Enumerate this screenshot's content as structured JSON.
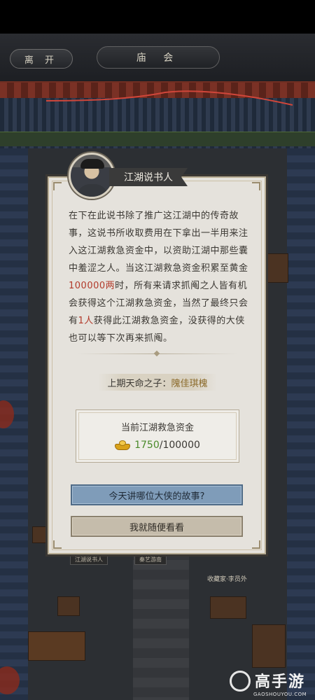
{
  "topbar": {
    "leave_label": "离 开",
    "title": "庙 会"
  },
  "scene": {
    "sign_left": "江湖说书人",
    "sign_mid": "秦艺游南",
    "npc_tag": "收藏家·李员外"
  },
  "dialog": {
    "speaker": "江湖说书人",
    "story": {
      "p1": "在下在此说书除了推广这江湖中的传奇故事，这说书所收取费用在下拿出一半用来注入这江湖救急资金中，以资助江湖中那些囊中羞涩之人。当这江湖救急资金积累至黄金",
      "amount": "100000两",
      "p2": "时，所有来请求抓阄之人皆有机会获得这个江湖救急资金，当然了最终只会有",
      "winners": "1人",
      "p3": "获得此江湖救急资金，没获得的大侠也可以等下次再来抓阄。"
    },
    "last_winner_label": "上期天命之子：",
    "last_winner_name": "隗佳琪槐",
    "fund": {
      "title": "当前江湖救急资金",
      "current": "1750",
      "separator": "/",
      "max": "100000",
      "icon": "gold-ingot-icon"
    },
    "primary_button": "今天讲哪位大侠的故事?",
    "secondary_button": "我就随便看看"
  },
  "watermark": {
    "brand": "高手游",
    "url": "GAOSHOUYOU.COM"
  },
  "colors": {
    "highlight_red": "#b23a2a",
    "fund_green": "#4a8a2a",
    "primary_button": "#7f9cb9",
    "secondary_button": "#c5bcab",
    "dialog_bg": "#e5e2dc"
  }
}
